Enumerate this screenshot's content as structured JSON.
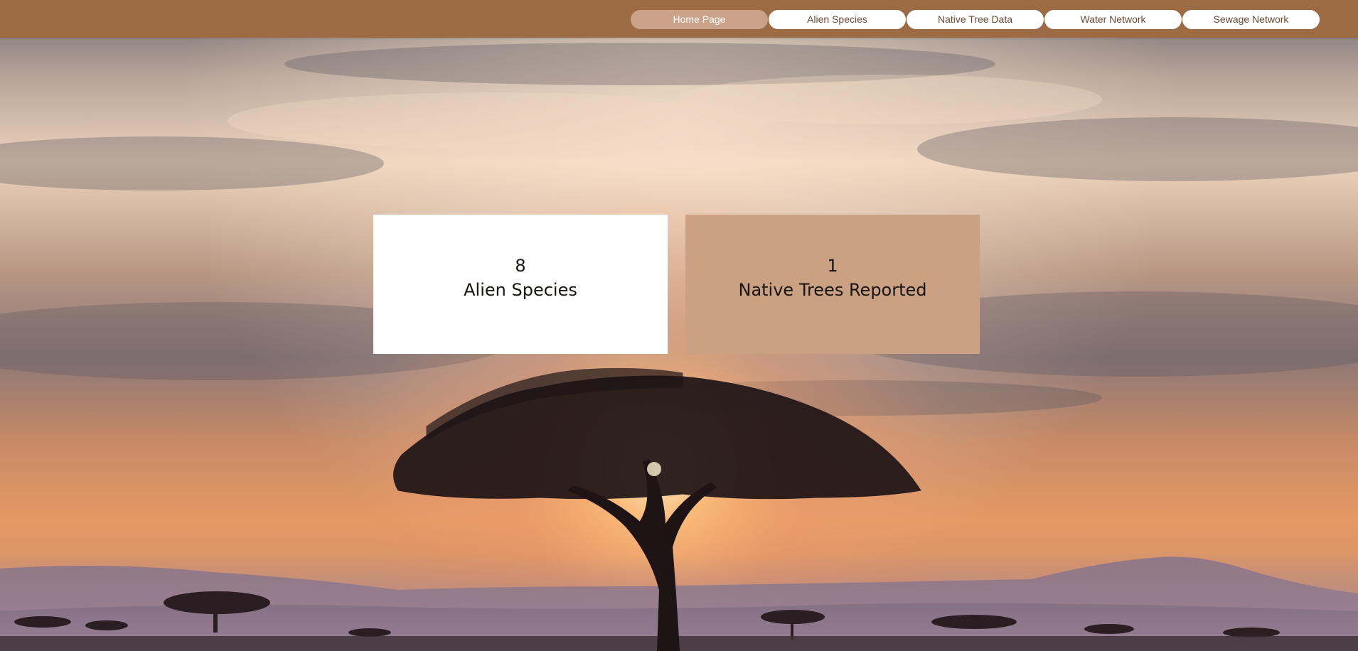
{
  "nav": {
    "items": [
      {
        "label": "Home Page",
        "active": true
      },
      {
        "label": "Alien Species",
        "active": false
      },
      {
        "label": "Native Tree Data",
        "active": false
      },
      {
        "label": "Water Network",
        "active": false
      },
      {
        "label": "Sewage Network",
        "active": false
      }
    ]
  },
  "stats": {
    "alien": {
      "value": "8",
      "label": "Alien Species"
    },
    "native": {
      "value": "1",
      "label": "Native Trees Reported"
    }
  },
  "background": {
    "subject": "savanna-sunset-acacia-tree"
  },
  "colors": {
    "header": "#9c6a43",
    "nav_active": "#c9a288",
    "nav_inactive": "#ffffff",
    "card_alien": "#ffffff",
    "card_native": "#cba183"
  }
}
